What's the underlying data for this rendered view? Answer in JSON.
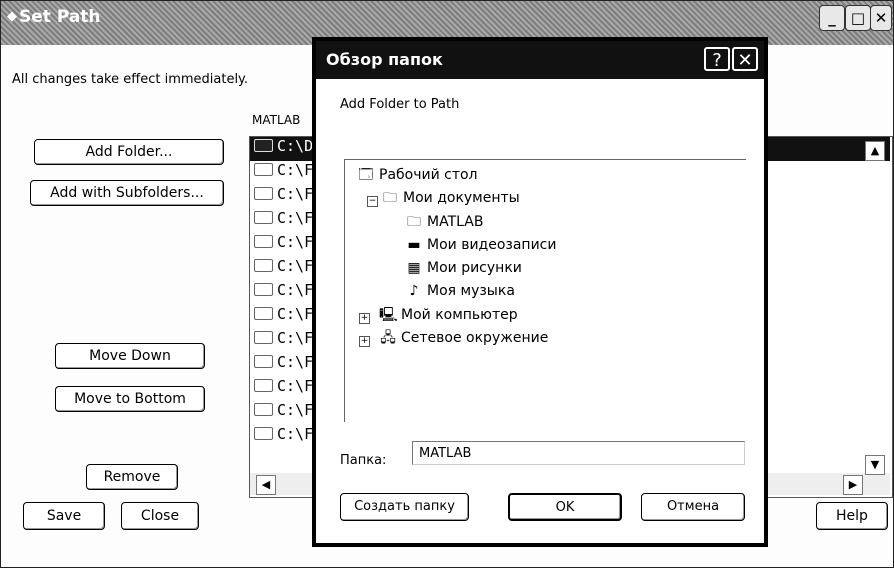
{
  "window": {
    "title": "Set Path",
    "info_text": "All changes take effect immediately.",
    "buttons": {
      "add_folder": "Add Folder...",
      "add_with_subfolders": "Add with Subfolders...",
      "move_down": "Move Down",
      "move_to_bottom": "Move to Bottom",
      "remove": "Remove",
      "save": "Save",
      "close": "Close",
      "help": "Help"
    },
    "list_header": "MATLAB",
    "path_rows": [
      "C:\\D",
      "C:\\F",
      "C:\\F",
      "C:\\F",
      "C:\\F",
      "C:\\F",
      "C:\\F",
      "C:\\F",
      "C:\\F",
      "C:\\F",
      "C:\\F",
      "C:\\F",
      "C:\\F"
    ]
  },
  "dialog": {
    "title": "Обзор папок",
    "help_glyph": "?",
    "close_glyph": "✕",
    "description": "Add Folder to Path",
    "tree": {
      "desktop": "Рабочий стол",
      "my_documents": "Мои документы",
      "matlab": "MATLAB",
      "my_videos": "Мои видеозаписи",
      "my_pictures": "Мои рисунки",
      "my_music": "Моя музыка",
      "my_computer": "Мой компьютер",
      "network": "Сетевое окружение"
    },
    "folder_label": "Папка:",
    "folder_value": "MATLAB",
    "buttons": {
      "new_folder": "Создать папку",
      "ok": "OK",
      "cancel": "Отмена"
    }
  }
}
